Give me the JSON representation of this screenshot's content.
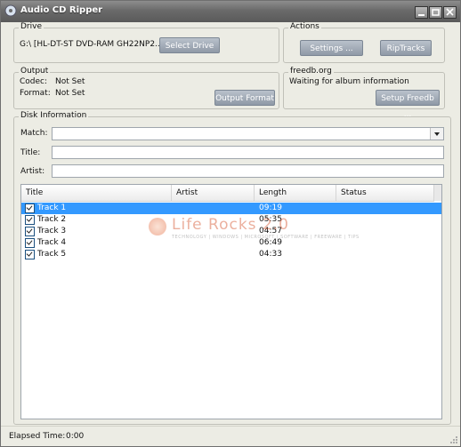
{
  "window": {
    "title": "Audio CD Ripper"
  },
  "drive": {
    "legend": "Drive",
    "name": "G:\\ [HL-DT-ST DVD-RAM GH22NP2...",
    "select_label": "Select Drive"
  },
  "actions": {
    "legend": "Actions",
    "settings_label": "Settings ...",
    "rip_label": "RipTracks"
  },
  "output": {
    "legend": "Output",
    "codec_label": "Codec:",
    "codec_value": "Not Set",
    "format_label": "Format:",
    "format_value": "Not Set",
    "button_label": "Output Format"
  },
  "freedb": {
    "legend": "freedb.org",
    "status": "Waiting for album information",
    "button_label": "Setup Freedb ..."
  },
  "disk": {
    "legend": "Disk Information",
    "match_label": "Match:",
    "match_value": "",
    "title_label": "Title:",
    "title_value": "",
    "artist_label": "Artist:",
    "artist_value": ""
  },
  "tracks": {
    "columns": [
      "Title",
      "Artist",
      "Length",
      "Status"
    ],
    "rows": [
      {
        "title": "Track 1",
        "length": "09:19",
        "selected": true,
        "checked": true
      },
      {
        "title": "Track 2",
        "length": "05:35",
        "selected": false,
        "checked": true
      },
      {
        "title": "Track 3",
        "length": "04:57",
        "selected": false,
        "checked": true
      },
      {
        "title": "Track 4",
        "length": "06:49",
        "selected": false,
        "checked": true
      },
      {
        "title": "Track 5",
        "length": "04:33",
        "selected": false,
        "checked": true
      }
    ]
  },
  "watermark": {
    "text": "Life Rocks 2.0",
    "subtext": "TECHNOLOGY | WINDOWS | MICROSOFT | SOFTWARE | FREEWARE | TIPS"
  },
  "status": {
    "elapsed_label": "Elapsed Time:",
    "elapsed_value": "0:00"
  },
  "colors": {
    "selection": "#3399ff",
    "button": "#9aa4b0",
    "window_bg": "#ecece4",
    "titlebar": "#6a6a6a"
  }
}
